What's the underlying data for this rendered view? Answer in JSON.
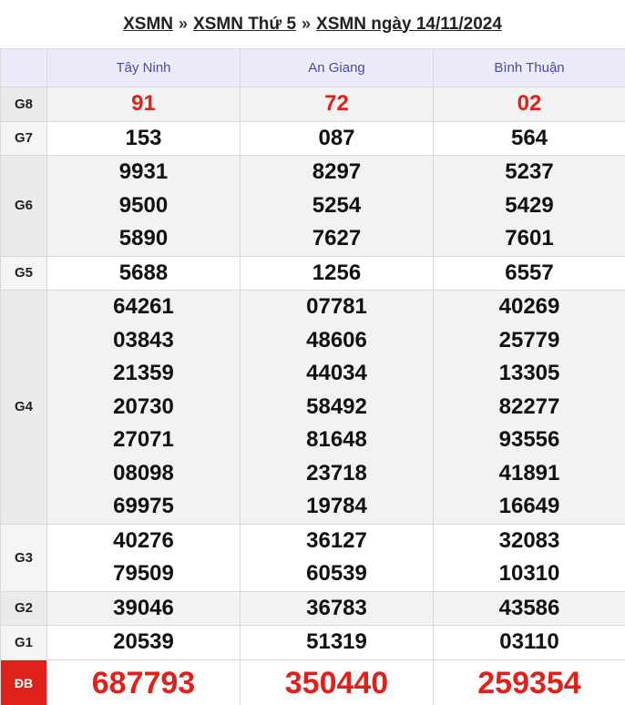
{
  "breadcrumb": {
    "items": [
      "XSMN",
      "XSMN Thứ 5",
      "XSMN ngày 14/11/2024"
    ],
    "separator": "»"
  },
  "provinces": [
    "Tây Ninh",
    "An Giang",
    "Bình Thuận"
  ],
  "rows": [
    {
      "label": "G8",
      "values": [
        [
          "91"
        ],
        [
          "72"
        ],
        [
          "02"
        ]
      ]
    },
    {
      "label": "G7",
      "values": [
        [
          "153"
        ],
        [
          "087"
        ],
        [
          "564"
        ]
      ]
    },
    {
      "label": "G6",
      "values": [
        [
          "9931",
          "9500",
          "5890"
        ],
        [
          "8297",
          "5254",
          "7627"
        ],
        [
          "5237",
          "5429",
          "7601"
        ]
      ]
    },
    {
      "label": "G5",
      "values": [
        [
          "5688"
        ],
        [
          "1256"
        ],
        [
          "6557"
        ]
      ]
    },
    {
      "label": "G4",
      "values": [
        [
          "64261",
          "03843",
          "21359",
          "20730",
          "27071",
          "08098",
          "69975"
        ],
        [
          "07781",
          "48606",
          "44034",
          "58492",
          "81648",
          "23718",
          "19784"
        ],
        [
          "40269",
          "25779",
          "13305",
          "82277",
          "93556",
          "41891",
          "16649"
        ]
      ]
    },
    {
      "label": "G3",
      "values": [
        [
          "40276",
          "79509"
        ],
        [
          "36127",
          "60539"
        ],
        [
          "32083",
          "10310"
        ]
      ]
    },
    {
      "label": "G2",
      "values": [
        [
          "39046"
        ],
        [
          "36783"
        ],
        [
          "43586"
        ]
      ]
    },
    {
      "label": "G1",
      "values": [
        [
          "20539"
        ],
        [
          "51319"
        ],
        [
          "03110"
        ]
      ]
    },
    {
      "label": "ĐB",
      "values": [
        [
          "687793"
        ],
        [
          "350440"
        ],
        [
          "259354"
        ]
      ]
    }
  ],
  "colors": {
    "header_bg": "#ecebfa",
    "header_text": "#4a4aa3",
    "highlight_red": "#e0201a"
  }
}
